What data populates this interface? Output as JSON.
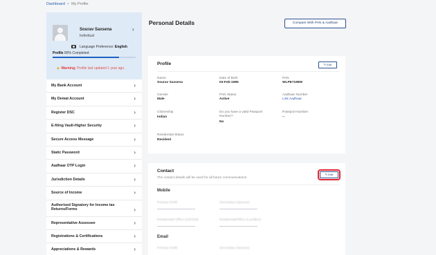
{
  "breadcrumb": {
    "home": "Dashboard",
    "separator": ">",
    "current": "My Profile"
  },
  "profile_card": {
    "name": "Sourav Saxsena",
    "type": "Individual",
    "language_label": "Language Preference:",
    "language_value": "English",
    "completion_label": "Profile",
    "completion_value": "80% Completed",
    "completion_fraction": 0.8,
    "warning_title": "Warning:",
    "warning_text": "Profile last updated 1 year ago.",
    "icons": {
      "avatar": "user-avatar-placeholder",
      "camera": "camera-icon",
      "chevron": "chevron-right-icon",
      "warning": "warning-icon"
    }
  },
  "sidebar": {
    "items": [
      {
        "label": "My Bank Account"
      },
      {
        "label": "My Demat Account"
      },
      {
        "label": "Register DSC"
      },
      {
        "label": "E-filing Vault-Higher Security"
      },
      {
        "label": "Secure Access Message"
      },
      {
        "label": "Static Password"
      },
      {
        "label": "Aadhaar OTP Login"
      },
      {
        "label": "Jurisdiction Details"
      },
      {
        "label": "Source of Income"
      },
      {
        "label": "Authorised Signatory for Income tax Returns/Forms"
      },
      {
        "label": "Representative Assessee"
      },
      {
        "label": "Registrations & Certifications"
      },
      {
        "label": "Appreciations & Rewards"
      }
    ]
  },
  "main": {
    "title": "Personal Details",
    "compare_button": "Compare With PAN & Aadhaar",
    "profile": {
      "title": "Profile",
      "edit": "Edit",
      "fields": {
        "name_label": "Name",
        "name_value": "Sourav Saxsena",
        "dob_label": "Date of Birth",
        "dob_value": "03-Feb-1995",
        "pan_label": "PAN",
        "pan_value": "WLPE7199W",
        "gender_label": "Gender",
        "gender_value": "Male",
        "pan_status_label": "PAN Status",
        "pan_status_value": "Active",
        "aadhaar_label": "Aadhaar Number",
        "aadhaar_value": "Link Aadhaar",
        "citizenship_label": "Citizenship",
        "citizenship_value": "Indian",
        "passport_q_label": "Do you have a valid Passport Number?",
        "passport_q_value": "No",
        "passport_no_label": "Passport Number",
        "passport_no_value": "--",
        "residential_label": "Residential Status",
        "residential_value": "Resident"
      }
    },
    "contact": {
      "title": "Contact",
      "subtitle": "The contact details will be used for all future communications",
      "edit": "Edit",
      "mobile_title": "Mobile",
      "primary_self": "Primary (Self)",
      "secondary_spouse": "Secondary (Spouse)",
      "residential_office_std": "Residential/ Office (ISD/Std)",
      "residential_office_landline": "Residential/Office (Landline)",
      "email_title": "Email",
      "email_primary": "Primary (Self)",
      "email_secondary": "Secondary (Spouse)"
    }
  }
}
